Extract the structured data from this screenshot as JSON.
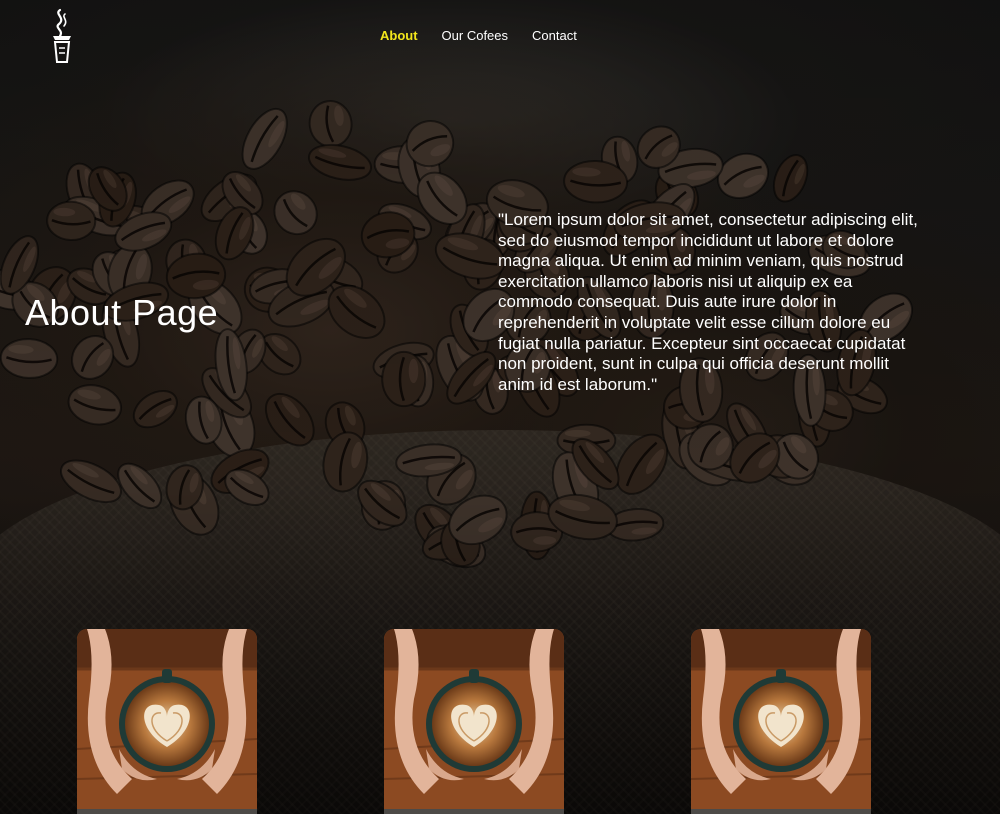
{
  "nav": {
    "items": [
      {
        "label": "About",
        "active": true
      },
      {
        "label": "Our Cofees",
        "active": false
      },
      {
        "label": "Contact",
        "active": false
      }
    ]
  },
  "hero": {
    "title": "About Page",
    "text": "\"Lorem ipsum dolor sit amet, consectetur adipiscing elit, sed do eiusmod tempor incididunt ut labore et dolore magna aliqua. Ut enim ad minim veniam, quis nostrud exercitation ullamco laboris nisi ut aliquip ex ea commodo consequat. Duis aute irure dolor in reprehenderit in voluptate velit esse cillum dolore eu fugiat nulla pariatur. Excepteur sint occaecat cupidatat non proident, sunt in culpa qui officia deserunt mollit anim id est laborum.\""
  },
  "cards": [
    {
      "image": "latte-cup-in-hands"
    },
    {
      "image": "latte-cup-in-hands"
    },
    {
      "image": "latte-cup-in-hands"
    }
  ],
  "colors": {
    "accent": "#f3e61c",
    "text": "#ffffff",
    "background": "#141210"
  }
}
